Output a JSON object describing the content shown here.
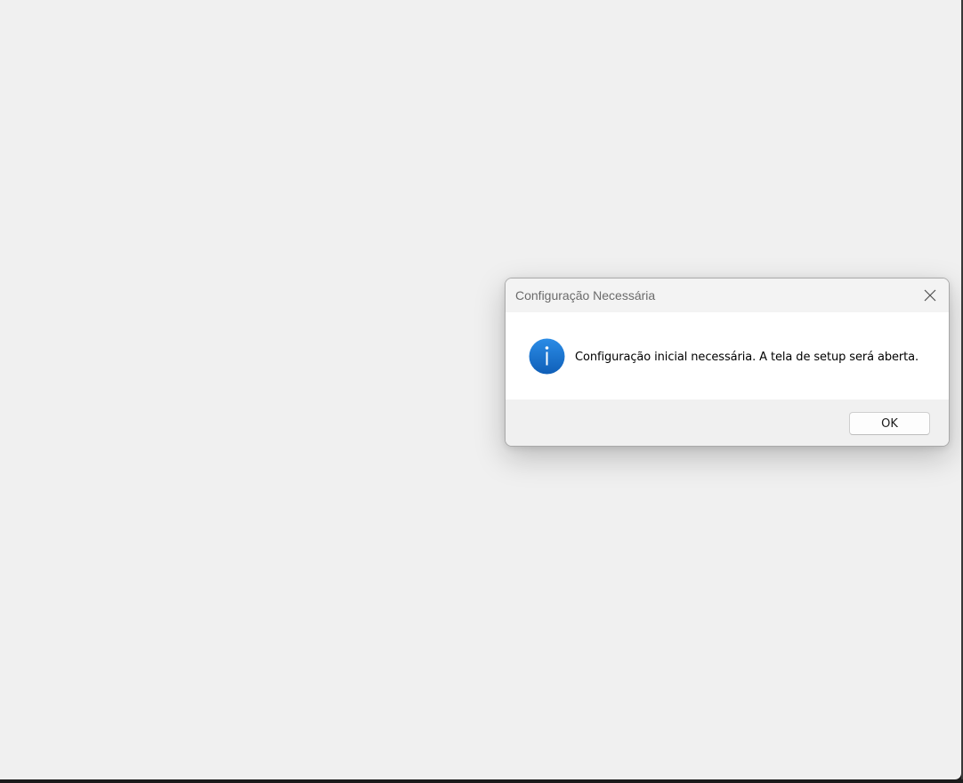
{
  "dialog": {
    "title": "Configuração Necessária",
    "message": "Configuração inicial necessária. A tela de setup será aberta.",
    "icon": "info-icon",
    "ok_label": "OK",
    "close_icon": "close-icon"
  },
  "colors": {
    "window_background": "#f0f0f0",
    "message_background": "#ffffff",
    "info_icon_blue": "#1a78d3"
  }
}
